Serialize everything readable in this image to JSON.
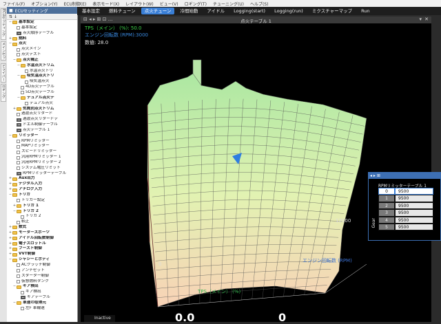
{
  "menu": [
    "ファイル(F)",
    "オプション(Y)",
    "ECU制御(E)",
    "表示モード(X)",
    "レイアウト(W)",
    "ビュー(V)",
    "ロギング(T)",
    "チューニング(U)",
    "ヘルプ(S)"
  ],
  "side_tabs": [
    "ECUセッティング",
    "メインセットアップ",
    "ドライバー",
    "ロギング"
  ],
  "tree": {
    "header": "ECUセッティング",
    "toolbar": "⇅ ↓",
    "items": [
      {
        "label": "基本設定",
        "depth": 0,
        "icon": "folder",
        "exp": "−",
        "bold": true
      },
      {
        "label": "基本設定",
        "depth": 1,
        "icon": "page",
        "exp": "",
        "bold": false
      },
      {
        "label": "点火順序テーブル",
        "depth": 1,
        "icon": "grid",
        "exp": "",
        "bold": false
      },
      {
        "label": "燃料",
        "depth": 0,
        "icon": "folder",
        "exp": "+",
        "bold": true
      },
      {
        "label": "点火",
        "depth": 0,
        "icon": "folder",
        "exp": "−",
        "bold": true
      },
      {
        "label": "点火メイン",
        "depth": 1,
        "icon": "page",
        "exp": "",
        "bold": false
      },
      {
        "label": "点火テスト",
        "depth": 1,
        "icon": "page",
        "exp": "",
        "bold": false
      },
      {
        "label": "点火補正",
        "depth": 1,
        "icon": "folder",
        "exp": "−",
        "bold": true
      },
      {
        "label": "水温点火トリム",
        "depth": 2,
        "icon": "folder",
        "exp": "−",
        "bold": true
      },
      {
        "label": "水温点火トリ",
        "depth": 3,
        "icon": "page",
        "exp": "",
        "bold": false
      },
      {
        "label": "吸気温点火トリ",
        "depth": 2,
        "icon": "folder",
        "exp": "−",
        "bold": true
      },
      {
        "label": "吸気温点火",
        "depth": 3,
        "icon": "page",
        "exp": "",
        "bold": false
      },
      {
        "label": "4D点火テーブル",
        "depth": 2,
        "icon": "page",
        "exp": "",
        "bold": false
      },
      {
        "label": "5D点火テーブル",
        "depth": 2,
        "icon": "page",
        "exp": "",
        "bold": false
      },
      {
        "label": "デュアル点火テ",
        "depth": 2,
        "icon": "folder",
        "exp": "−",
        "bold": true
      },
      {
        "label": "デュアル点火",
        "depth": 3,
        "icon": "page",
        "exp": "",
        "bold": false
      },
      {
        "label": "気筒別点火トリム",
        "depth": 1,
        "icon": "folder",
        "exp": "+",
        "bold": true
      },
      {
        "label": "過渡点火リタード",
        "depth": 1,
        "icon": "page",
        "exp": "",
        "bold": false
      },
      {
        "label": "過渡点火リタードテ",
        "depth": 1,
        "icon": "grid",
        "exp": "",
        "bold": false
      },
      {
        "label": "ドエル制御テーブル",
        "depth": 1,
        "icon": "grid",
        "exp": "",
        "bold": false
      },
      {
        "label": "点火テーブル 1",
        "depth": 1,
        "icon": "grid",
        "exp": "",
        "bold": false
      },
      {
        "label": "リミッター",
        "depth": 0,
        "icon": "folder",
        "exp": "−",
        "bold": true
      },
      {
        "label": "RPMリミッター",
        "depth": 1,
        "icon": "page",
        "exp": "",
        "bold": false
      },
      {
        "label": "MAPリミッター",
        "depth": 1,
        "icon": "page",
        "exp": "",
        "bold": false
      },
      {
        "label": "スピードリミッター",
        "depth": 1,
        "icon": "page",
        "exp": "",
        "bold": false
      },
      {
        "label": "汎用RPMリミッター 1",
        "depth": 1,
        "icon": "page",
        "exp": "",
        "bold": false
      },
      {
        "label": "汎用RPMリミッター 2",
        "depth": 1,
        "icon": "page",
        "exp": "",
        "bold": false
      },
      {
        "label": "システム電圧リミット",
        "depth": 1,
        "icon": "page",
        "exp": "",
        "bold": false
      },
      {
        "label": "RPMリミッターテーブル",
        "depth": 1,
        "icon": "grid",
        "exp": "",
        "bold": false
      },
      {
        "label": "Aux出力",
        "depth": 0,
        "icon": "folder",
        "exp": "+",
        "bold": true
      },
      {
        "label": "デジタル入力",
        "depth": 0,
        "icon": "folder",
        "exp": "+",
        "bold": true
      },
      {
        "label": "アナログ入力",
        "depth": 0,
        "icon": "folder",
        "exp": "+",
        "bold": true
      },
      {
        "label": "トリガ",
        "depth": 0,
        "icon": "folder",
        "exp": "−",
        "bold": true
      },
      {
        "label": "トリガー設定",
        "depth": 1,
        "icon": "page",
        "exp": "",
        "bold": false
      },
      {
        "label": "トリガ 1",
        "depth": 1,
        "icon": "folder",
        "exp": "+",
        "bold": true
      },
      {
        "label": "トリガ 2",
        "depth": 1,
        "icon": "folder",
        "exp": "−",
        "bold": true
      },
      {
        "label": "トリガ 2",
        "depth": 2,
        "icon": "page",
        "exp": "",
        "bold": false
      },
      {
        "label": "較正",
        "depth": 1,
        "icon": "page",
        "exp": "",
        "bold": false
      },
      {
        "label": "数式",
        "depth": 0,
        "icon": "folder",
        "exp": "+",
        "bold": true
      },
      {
        "label": "モータースポーツ",
        "depth": 0,
        "icon": "folder",
        "exp": "+",
        "bold": true
      },
      {
        "label": "アイドル回転数制御",
        "depth": 0,
        "icon": "folder",
        "exp": "+",
        "bold": true
      },
      {
        "label": "電子スロットル",
        "depth": 0,
        "icon": "folder",
        "exp": "+",
        "bold": true
      },
      {
        "label": "ブースト制御",
        "depth": 0,
        "icon": "folder",
        "exp": "+",
        "bold": true
      },
      {
        "label": "VVT制御",
        "depth": 0,
        "icon": "folder",
        "exp": "+",
        "bold": true
      },
      {
        "label": "シャシーとボディ",
        "depth": 0,
        "icon": "folder",
        "exp": "−",
        "bold": true
      },
      {
        "label": "ACクラッチ制御",
        "depth": 1,
        "icon": "page",
        "exp": "",
        "bold": false
      },
      {
        "label": "アンチゼット",
        "depth": 1,
        "icon": "page",
        "exp": "",
        "bold": false
      },
      {
        "label": "スターター制御",
        "depth": 1,
        "icon": "page",
        "exp": "",
        "bold": false
      },
      {
        "label": "仮想燃料タンク",
        "depth": 1,
        "icon": "page",
        "exp": "",
        "bold": false
      },
      {
        "label": "ギア検出",
        "depth": 1,
        "icon": "folder",
        "exp": "−",
        "bold": true
      },
      {
        "label": "ギア検出",
        "depth": 2,
        "icon": "page",
        "exp": "",
        "bold": false
      },
      {
        "label": "ギアテーブル",
        "depth": 2,
        "icon": "grid",
        "exp": "",
        "bold": false
      },
      {
        "label": "車速の取得元",
        "depth": 1,
        "icon": "folder",
        "exp": "−",
        "bold": true
      },
      {
        "label": "左F 車輪速",
        "depth": 2,
        "icon": "page",
        "exp": "",
        "bold": false
      }
    ]
  },
  "tabs": [
    {
      "label": "基本設定",
      "active": false
    },
    {
      "label": "燃料チューン",
      "active": false
    },
    {
      "label": "点火チューン",
      "active": true
    },
    {
      "label": "冷間始動",
      "active": false
    },
    {
      "label": "アイドル",
      "active": false
    },
    {
      "label": "Logging(start)",
      "active": false
    },
    {
      "label": "Logging(run)",
      "active": false
    },
    {
      "label": "ミクスチャーマップ",
      "active": false
    },
    {
      "label": "Run",
      "active": false
    }
  ],
  "window": {
    "title": "点火テーブル 1",
    "controls": "⊟ ◂ ▸ ⊞  ⊡ ..."
  },
  "info": {
    "line1": "TPS（メイン） (%): 50.0",
    "line2": "エンジン回転数 (RPM):3000",
    "line3": "数値: 28.0",
    "line1_color": "#3dd44a",
    "line2_color": "#3a8ae0",
    "line3_color": "#e6e6e6"
  },
  "plot": {
    "axis_x_label": "TPS（メイン） (%)",
    "axis_rpm_label": "エンジン回転数 (RPM)",
    "tick_zero": "0",
    "tick_12000": "12000",
    "x_color": "#2fb34a",
    "rpm_color": "#3a6fd0"
  },
  "rpm_table": {
    "header": "◂ ▸ ⊞",
    "title": "RPMリミッターテーブル 1",
    "axis": "Gear",
    "rows": [
      {
        "index": "0",
        "value": "9500",
        "selected": true
      },
      {
        "index": "1",
        "value": "9500",
        "selected": false
      },
      {
        "index": "2",
        "value": "9500",
        "selected": false
      },
      {
        "index": "3",
        "value": "9500",
        "selected": false
      },
      {
        "index": "4",
        "value": "9500",
        "selected": false
      },
      {
        "index": "5",
        "value": "9500",
        "selected": false
      }
    ]
  },
  "status": {
    "left": "Inactive",
    "big1": "0.0",
    "big2": "0"
  }
}
